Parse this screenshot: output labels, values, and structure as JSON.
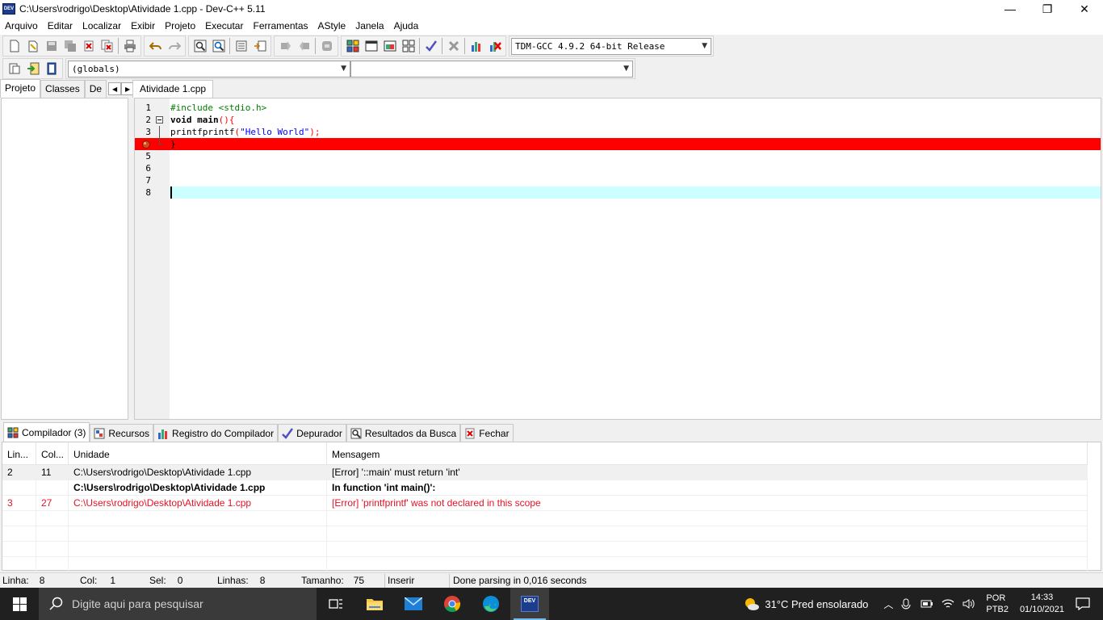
{
  "window": {
    "app_icon_text": "DEV",
    "title": "C:\\Users\\rodrigo\\Desktop\\Atividade 1.cpp - Dev-C++ 5.11",
    "minimize": "—",
    "maximize": "❐",
    "close": "✕"
  },
  "menu": [
    "Arquivo",
    "Editar",
    "Localizar",
    "Exibir",
    "Projeto",
    "Executar",
    "Ferramentas",
    "AStyle",
    "Janela",
    "Ajuda"
  ],
  "toolbar": {
    "compiler_select": "TDM-GCC 4.9.2 64-bit Release",
    "scope_select": "(globals)",
    "member_select": ""
  },
  "left_tabs": [
    "Projeto",
    "Classes",
    "De"
  ],
  "editor": {
    "tab": "Atividade 1.cpp",
    "lines": [
      {
        "n": "1",
        "text": "#include <stdio.h>"
      },
      {
        "n": "2",
        "text_kw": "void main",
        "text_sym": "(){"
      },
      {
        "n": "3",
        "text_a": "printfprintf",
        "text_b": "(",
        "text_str": "\"Hello World\"",
        "text_c": ");"
      },
      {
        "n": "4",
        "text": "}"
      },
      {
        "n": "5",
        "text": ""
      },
      {
        "n": "6",
        "text": ""
      },
      {
        "n": "7",
        "text": ""
      },
      {
        "n": "8",
        "text": ""
      }
    ],
    "colors": {
      "error_line": "#ff0000",
      "current_line": "#ccffff",
      "preprocessor": "#008000",
      "string": "#0000ff"
    }
  },
  "bottom_tabs": [
    "Compilador (3)",
    "Recursos",
    "Registro do Compilador",
    "Depurador",
    "Resultados da Busca",
    "Fechar"
  ],
  "messages": {
    "columns": [
      "Lin...",
      "Col...",
      "Unidade",
      "Mensagem"
    ],
    "rows": [
      {
        "line": "2",
        "col": "11",
        "unit": "C:\\Users\\rodrigo\\Desktop\\Atividade 1.cpp",
        "message": "[Error] '::main' must return 'int'"
      },
      {
        "line": "",
        "col": "",
        "unit": "C:\\Users\\rodrigo\\Desktop\\Atividade 1.cpp",
        "message": "In function 'int main()':"
      },
      {
        "line": "3",
        "col": "27",
        "unit": "C:\\Users\\rodrigo\\Desktop\\Atividade 1.cpp",
        "message": "[Error] 'printfprintf' was not declared in this scope"
      }
    ]
  },
  "status": {
    "linha_label": "Linha:",
    "linha": "8",
    "col_label": "Col:",
    "col": "1",
    "sel_label": "Sel:",
    "sel": "0",
    "linhas_label": "Linhas:",
    "linhas": "8",
    "tamanho_label": "Tamanho:",
    "tamanho": "75",
    "mode": "Inserir",
    "message": "Done parsing in 0,016 seconds"
  },
  "taskbar": {
    "search_placeholder": "Digite aqui para pesquisar",
    "active_app_text": "DEV",
    "weather": "31°C  Pred ensolarado",
    "lang_1": "POR",
    "lang_2": "PTB2",
    "time": "14:33",
    "date": "01/10/2021"
  }
}
